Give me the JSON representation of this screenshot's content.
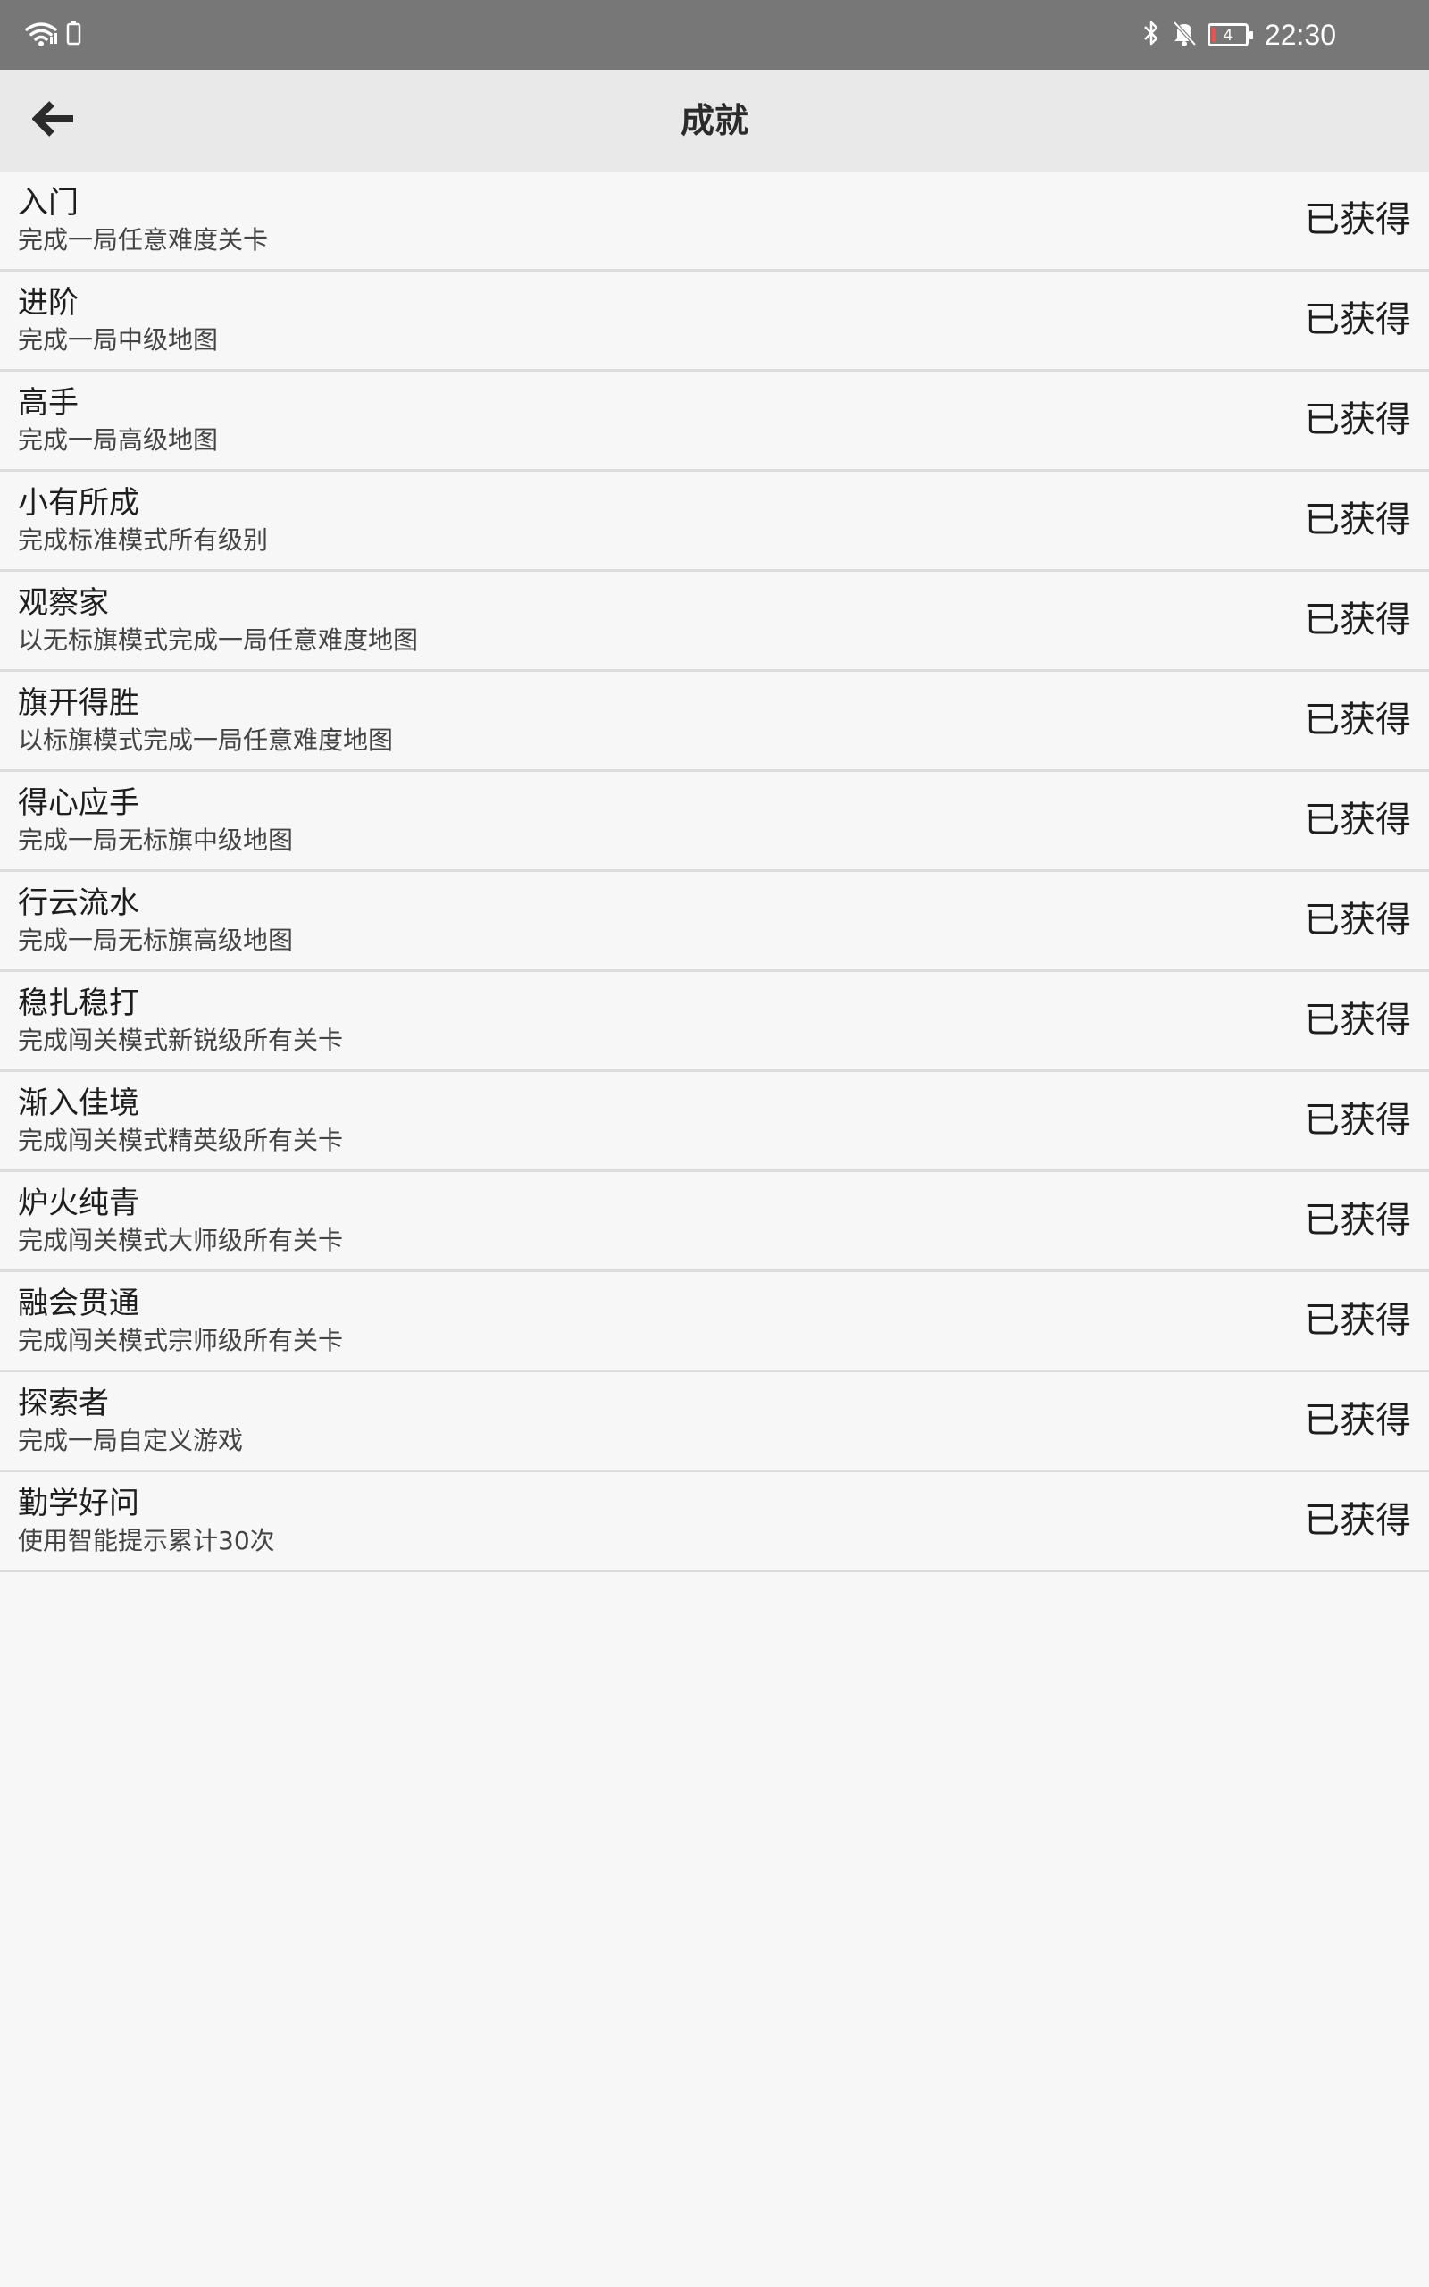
{
  "status_bar": {
    "time": "22:30",
    "battery_level": "4",
    "icons": [
      "wifi-icon",
      "phone-icon",
      "bluetooth-icon",
      "bell-off-icon",
      "battery-icon"
    ]
  },
  "header": {
    "title": "成就",
    "back_icon": "arrow-left-icon"
  },
  "achievements": [
    {
      "title": "入门",
      "description": "完成一局任意难度关卡",
      "status": "已获得"
    },
    {
      "title": "进阶",
      "description": "完成一局中级地图",
      "status": "已获得"
    },
    {
      "title": "高手",
      "description": "完成一局高级地图",
      "status": "已获得"
    },
    {
      "title": "小有所成",
      "description": "完成标准模式所有级别",
      "status": "已获得"
    },
    {
      "title": "观察家",
      "description": "以无标旗模式完成一局任意难度地图",
      "status": "已获得"
    },
    {
      "title": "旗开得胜",
      "description": "以标旗模式完成一局任意难度地图",
      "status": "已获得"
    },
    {
      "title": "得心应手",
      "description": "完成一局无标旗中级地图",
      "status": "已获得"
    },
    {
      "title": "行云流水",
      "description": "完成一局无标旗高级地图",
      "status": "已获得"
    },
    {
      "title": "稳扎稳打",
      "description": "完成闯关模式新锐级所有关卡",
      "status": "已获得"
    },
    {
      "title": "渐入佳境",
      "description": "完成闯关模式精英级所有关卡",
      "status": "已获得"
    },
    {
      "title": "炉火纯青",
      "description": "完成闯关模式大师级所有关卡",
      "status": "已获得"
    },
    {
      "title": "融会贯通",
      "description": "完成闯关模式宗师级所有关卡",
      "status": "已获得"
    },
    {
      "title": "探索者",
      "description": "完成一局自定义游戏",
      "status": "已获得"
    },
    {
      "title": "勤学好问",
      "description": "使用智能提示累计30次",
      "status": "已获得"
    }
  ]
}
